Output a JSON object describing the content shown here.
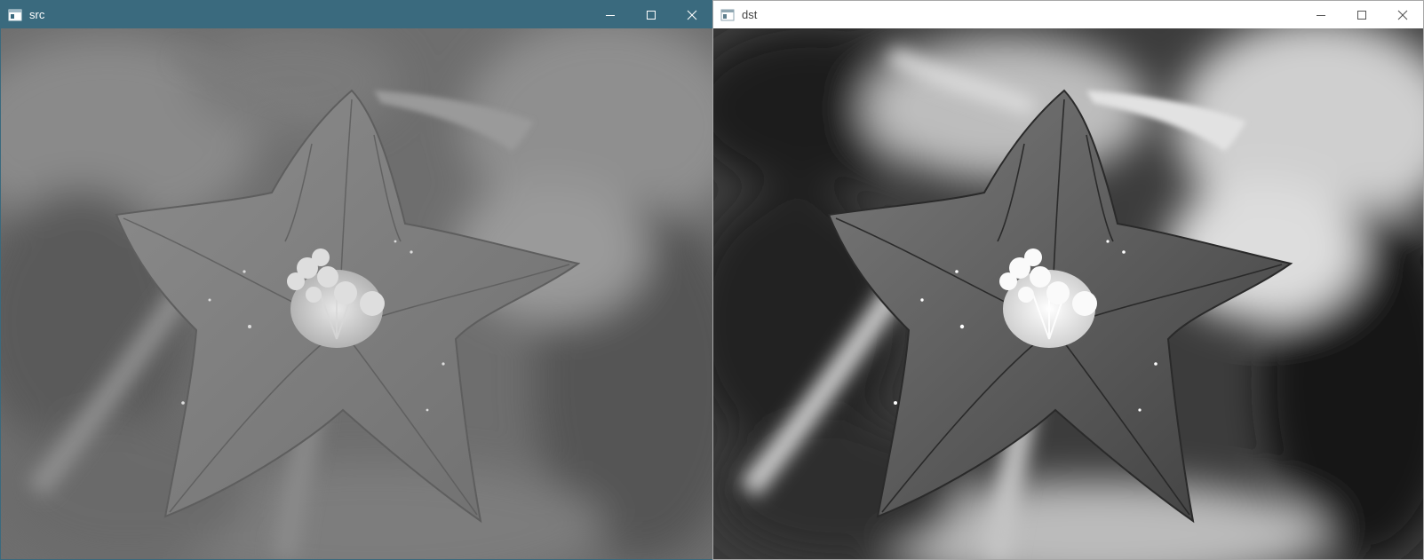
{
  "windows": [
    {
      "title": "src",
      "state": "active",
      "titlebar_color": "#3a6a7e",
      "image_kind": "grayscale photo of a five-petal star-shaped flower (original contrast)"
    },
    {
      "title": "dst",
      "state": "inactive",
      "titlebar_color": "#ffffff",
      "image_kind": "grayscale photo of the same flower (enhanced contrast)"
    }
  ],
  "icons": {
    "app": "app-window-icon",
    "minimize": "minimize-icon",
    "maximize": "maximize-icon",
    "close": "close-icon"
  }
}
